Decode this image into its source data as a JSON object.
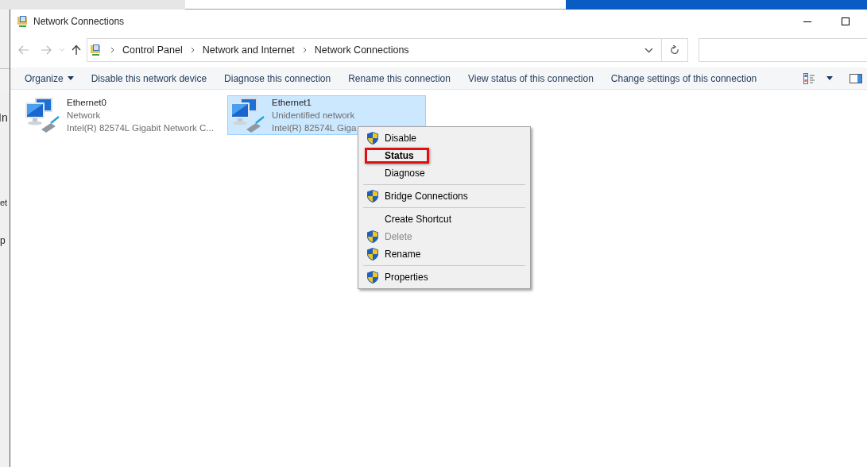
{
  "background_window": {
    "texts": [
      "In",
      "et",
      "p"
    ]
  },
  "window": {
    "title": "Network Connections"
  },
  "address_bar": {
    "breadcrumb": [
      "Control Panel",
      "Network and Internet",
      "Network Connections"
    ]
  },
  "toolbar": {
    "items": [
      {
        "label": "Organize",
        "dropdown": true
      },
      {
        "label": "Disable this network device",
        "dropdown": false
      },
      {
        "label": "Diagnose this connection",
        "dropdown": false
      },
      {
        "label": "Rename this connection",
        "dropdown": false
      },
      {
        "label": "View status of this connection",
        "dropdown": false
      },
      {
        "label": "Change settings of this connection",
        "dropdown": false
      }
    ]
  },
  "connections": [
    {
      "name": "Ethernet0",
      "status": "Network",
      "adapter": "Intel(R) 82574L Gigabit Network C...",
      "selected": false
    },
    {
      "name": "Ethernet1",
      "status": "Unidentified network",
      "adapter": "Intel(R) 82574L Giga",
      "selected": true
    }
  ],
  "context_menu": {
    "items": [
      {
        "kind": "item",
        "label": "Disable",
        "shield": true,
        "bold": false,
        "disabled": false,
        "highlighted": false
      },
      {
        "kind": "item",
        "label": "Status",
        "shield": false,
        "bold": true,
        "disabled": false,
        "highlighted": true
      },
      {
        "kind": "item",
        "label": "Diagnose",
        "shield": false,
        "bold": false,
        "disabled": false,
        "highlighted": false
      },
      {
        "kind": "separator"
      },
      {
        "kind": "item",
        "label": "Bridge Connections",
        "shield": true,
        "bold": false,
        "disabled": false,
        "highlighted": false
      },
      {
        "kind": "separator"
      },
      {
        "kind": "item",
        "label": "Create Shortcut",
        "shield": false,
        "bold": false,
        "disabled": false,
        "highlighted": false
      },
      {
        "kind": "item",
        "label": "Delete",
        "shield": true,
        "bold": false,
        "disabled": true,
        "highlighted": false
      },
      {
        "kind": "item",
        "label": "Rename",
        "shield": true,
        "bold": false,
        "disabled": false,
        "highlighted": false
      },
      {
        "kind": "separator"
      },
      {
        "kind": "item",
        "label": "Properties",
        "shield": true,
        "bold": false,
        "disabled": false,
        "highlighted": false
      }
    ]
  }
}
